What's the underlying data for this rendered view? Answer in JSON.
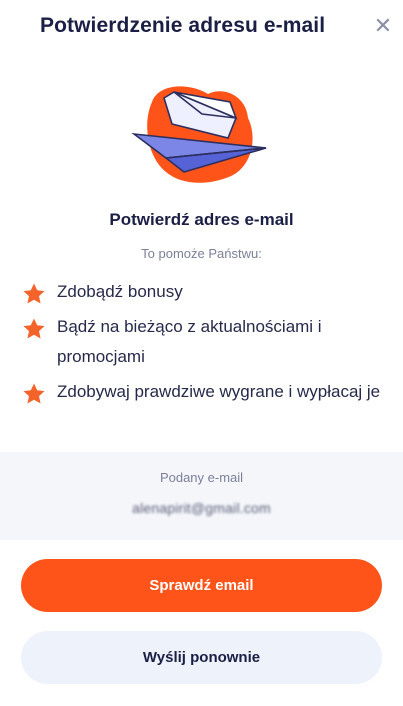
{
  "header": {
    "title": "Potwierdzenie adresu e-mail",
    "close_symbol": "✕"
  },
  "illustration": {
    "icon": "paper-plane-envelope-icon",
    "blob_color": "#fe5419",
    "plane_color": "#7b86e6"
  },
  "content": {
    "subtitle": "Potwierdź adres e-mail",
    "helper": "To pomoże Państwu:",
    "benefit_icon": "star-icon",
    "benefit_icon_color": "#f4642a",
    "benefits": [
      "Zdobądź bonusy",
      "Bądź na bieżąco z aktualnościami i promocjami",
      "Zdobywaj prawdziwe wygrane i wypłacaj je"
    ]
  },
  "email": {
    "label": "Podany e-mail",
    "value": "alenapirit@gmail.com"
  },
  "actions": {
    "check_label": "Sprawdź email",
    "resend_label": "Wyślij ponownie"
  },
  "colors": {
    "accent": "#fe5419",
    "secondary_button": "#eef2fb",
    "panel": "#f4f6fa",
    "text": "#1c1f45"
  }
}
